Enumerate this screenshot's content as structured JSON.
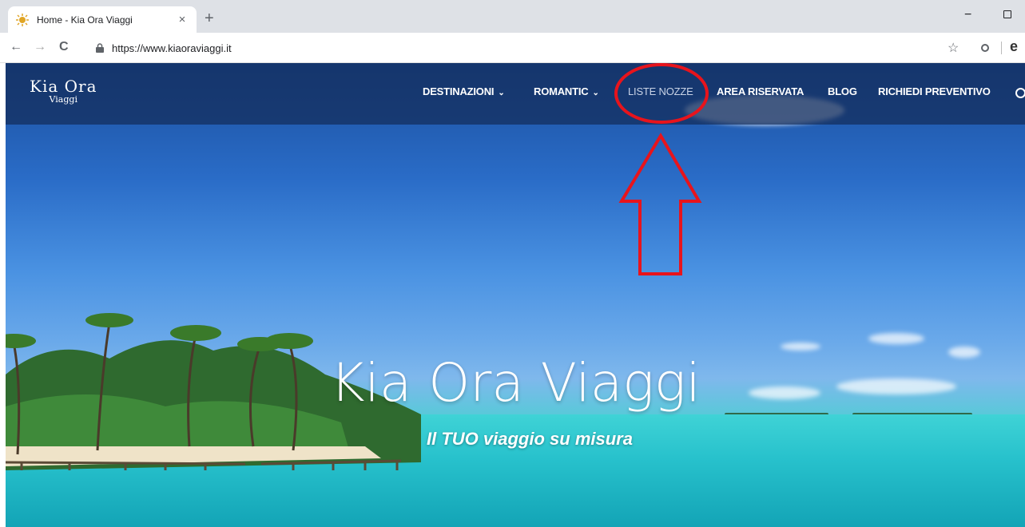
{
  "browser": {
    "tab_title": "Home - Kia Ora Viaggi",
    "tab_close": "×",
    "new_tab": "+",
    "minimize": "−",
    "back": "←",
    "forward": "→",
    "reload": "C",
    "url": "https://www.kiaoraviaggi.it",
    "bookmark_star": "☆",
    "profile": "e"
  },
  "site": {
    "logo_top": "Kia Ora",
    "logo_bottom": "Viaggi",
    "nav": {
      "destinazioni": "DESTINAZIONI",
      "romantic": "ROMANTIC",
      "liste_nozze": "LISTE NOZZE",
      "area_riservata": "AREA RISERVATA",
      "blog": "BLOG",
      "richiedi_preventivo": "RICHIEDI PREVENTIVO",
      "chevron": "⌄"
    },
    "hero_title": "Kia Ora Viaggi",
    "hero_subtitle": "Il TUO viaggio su misura"
  },
  "colors": {
    "annotation": "#e8141c",
    "navbar": "#142d5a"
  }
}
